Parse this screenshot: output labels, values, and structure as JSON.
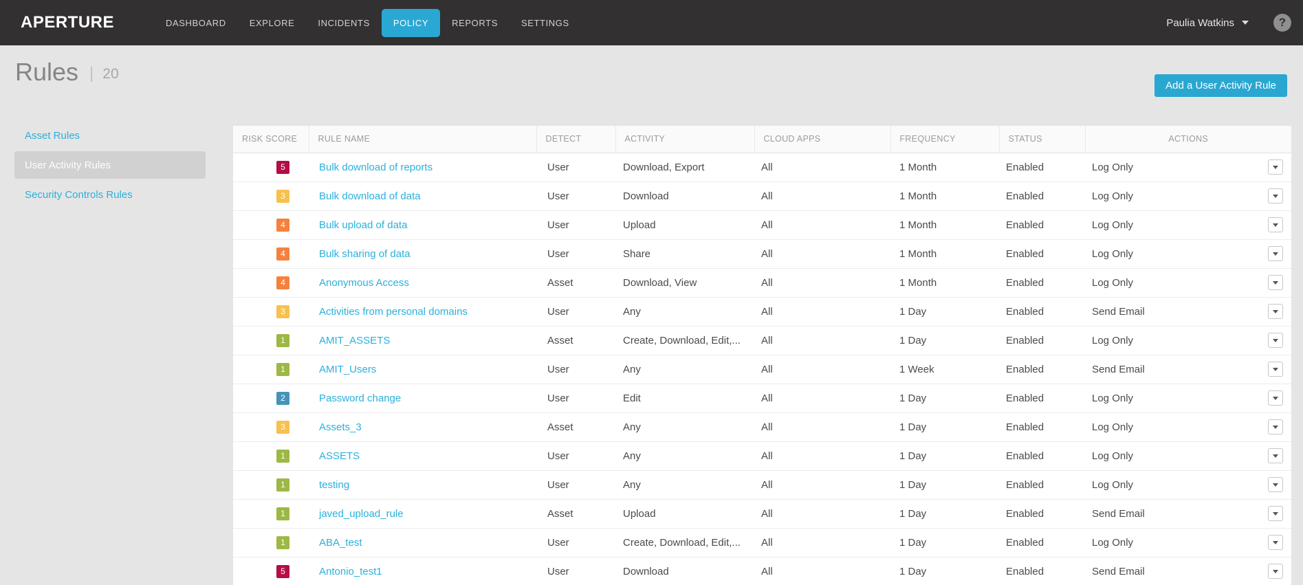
{
  "nav": {
    "brand": "APERTURE",
    "items": [
      {
        "id": "dashboard",
        "label": "DASHBOARD",
        "active": false
      },
      {
        "id": "explore",
        "label": "EXPLORE",
        "active": false
      },
      {
        "id": "incidents",
        "label": "INCIDENTS",
        "active": false
      },
      {
        "id": "policy",
        "label": "POLICY",
        "active": true
      },
      {
        "id": "reports",
        "label": "REPORTS",
        "active": false
      },
      {
        "id": "settings",
        "label": "SETTINGS",
        "active": false
      }
    ],
    "user_name": "Paulia Watkins",
    "help_glyph": "?"
  },
  "page": {
    "title": "Rules",
    "divider": "|",
    "count": "20",
    "add_button_label": "Add a User Activity Rule"
  },
  "sidebar": {
    "items": [
      {
        "id": "asset-rules",
        "label": "Asset Rules",
        "active": false
      },
      {
        "id": "user-activity-rules",
        "label": "User Activity Rules",
        "active": true
      },
      {
        "id": "security-controls-rules",
        "label": "Security Controls Rules",
        "active": false
      }
    ]
  },
  "table": {
    "columns": [
      "RISK SCORE",
      "RULE NAME",
      "DETECT",
      "ACTIVITY",
      "CLOUD APPS",
      "FREQUENCY",
      "STATUS",
      "ACTIONS"
    ],
    "risk_colors": {
      "1": "#9cb845",
      "2": "#4493b9",
      "3": "#f8c04d",
      "4": "#f5813c",
      "5": "#b50d44"
    },
    "rows": [
      {
        "risk": "5",
        "name": "Bulk download of reports",
        "detect": "User",
        "activity": "Download, Export",
        "cloud_apps": "All",
        "frequency": "1 Month",
        "status": "Enabled",
        "action": "Log Only"
      },
      {
        "risk": "3",
        "name": "Bulk download of data",
        "detect": "User",
        "activity": "Download",
        "cloud_apps": "All",
        "frequency": "1 Month",
        "status": "Enabled",
        "action": "Log Only"
      },
      {
        "risk": "4",
        "name": "Bulk upload of data",
        "detect": "User",
        "activity": "Upload",
        "cloud_apps": "All",
        "frequency": "1 Month",
        "status": "Enabled",
        "action": "Log Only"
      },
      {
        "risk": "4",
        "name": "Bulk sharing of data",
        "detect": "User",
        "activity": "Share",
        "cloud_apps": "All",
        "frequency": "1 Month",
        "status": "Enabled",
        "action": "Log Only"
      },
      {
        "risk": "4",
        "name": "Anonymous Access",
        "detect": "Asset",
        "activity": "Download, View",
        "cloud_apps": "All",
        "frequency": "1 Month",
        "status": "Enabled",
        "action": "Log Only"
      },
      {
        "risk": "3",
        "name": "Activities from personal domains",
        "detect": "User",
        "activity": "Any",
        "cloud_apps": "All",
        "frequency": "1 Day",
        "status": "Enabled",
        "action": "Send Email"
      },
      {
        "risk": "1",
        "name": "AMIT_ASSETS",
        "detect": "Asset",
        "activity": "Create, Download, Edit,...",
        "cloud_apps": "All",
        "frequency": "1 Day",
        "status": "Enabled",
        "action": "Log Only"
      },
      {
        "risk": "1",
        "name": "AMIT_Users",
        "detect": "User",
        "activity": "Any",
        "cloud_apps": "All",
        "frequency": "1 Week",
        "status": "Enabled",
        "action": "Send Email"
      },
      {
        "risk": "2",
        "name": "Password change",
        "detect": "User",
        "activity": "Edit",
        "cloud_apps": "All",
        "frequency": "1 Day",
        "status": "Enabled",
        "action": "Log Only"
      },
      {
        "risk": "3",
        "name": "Assets_3",
        "detect": "Asset",
        "activity": "Any",
        "cloud_apps": "All",
        "frequency": "1 Day",
        "status": "Enabled",
        "action": "Log Only"
      },
      {
        "risk": "1",
        "name": "ASSETS",
        "detect": "User",
        "activity": "Any",
        "cloud_apps": "All",
        "frequency": "1 Day",
        "status": "Enabled",
        "action": "Log Only"
      },
      {
        "risk": "1",
        "name": "testing",
        "detect": "User",
        "activity": "Any",
        "cloud_apps": "All",
        "frequency": "1 Day",
        "status": "Enabled",
        "action": "Log Only"
      },
      {
        "risk": "1",
        "name": "javed_upload_rule",
        "detect": "Asset",
        "activity": "Upload",
        "cloud_apps": "All",
        "frequency": "1 Day",
        "status": "Enabled",
        "action": "Send Email"
      },
      {
        "risk": "1",
        "name": "ABA_test",
        "detect": "User",
        "activity": "Create, Download, Edit,...",
        "cloud_apps": "All",
        "frequency": "1 Day",
        "status": "Enabled",
        "action": "Log Only"
      },
      {
        "risk": "5",
        "name": "Antonio_test1",
        "detect": "User",
        "activity": "Download",
        "cloud_apps": "All",
        "frequency": "1 Day",
        "status": "Enabled",
        "action": "Send Email"
      }
    ]
  }
}
